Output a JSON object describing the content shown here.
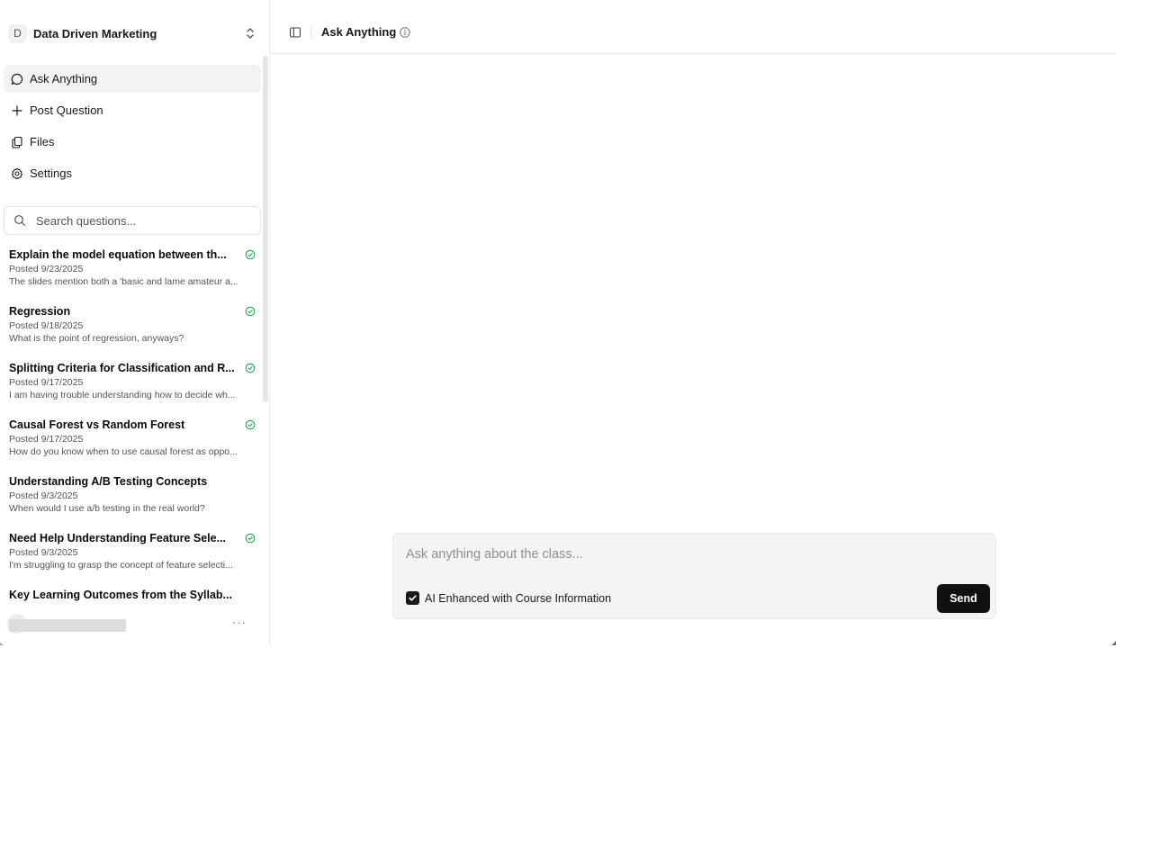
{
  "workspace": {
    "initial": "D",
    "name": "Data Driven Marketing"
  },
  "nav": {
    "items": [
      {
        "label": "Ask Anything",
        "icon": "chat-bubble-icon",
        "active": true
      },
      {
        "label": "Post Question",
        "icon": "plus-icon",
        "active": false
      },
      {
        "label": "Files",
        "icon": "files-icon",
        "active": false
      },
      {
        "label": "Settings",
        "icon": "gear-icon",
        "active": false
      }
    ]
  },
  "search": {
    "placeholder": "Search questions..."
  },
  "questions": [
    {
      "title": "Explain the model equation between th...",
      "date": "Posted 9/23/2025",
      "snippet": "The slides mention both a 'basic and lame amateur a...",
      "answered": true
    },
    {
      "title": "Regression",
      "date": "Posted 9/18/2025",
      "snippet": "What is the point of regression, anyways?",
      "answered": true
    },
    {
      "title": "Splitting Criteria for Classification and R...",
      "date": "Posted 9/17/2025",
      "snippet": "I am having trouble understanding how to decide wh...",
      "answered": true
    },
    {
      "title": "Causal Forest vs Random Forest",
      "date": "Posted 9/17/2025",
      "snippet": "How do you know when to use causal forest as oppo...",
      "answered": true
    },
    {
      "title": "Understanding A/B Testing Concepts",
      "date": "Posted 9/3/2025",
      "snippet": "When would I use a/b testing in the real world?",
      "answered": false
    },
    {
      "title": "Need Help Understanding Feature Sele...",
      "date": "Posted 9/3/2025",
      "snippet": "I'm struggling to grasp the concept of feature selecti...",
      "answered": true
    },
    {
      "title": "Key Learning Outcomes from the Syllab...",
      "date": "",
      "snippet": "",
      "answered": false
    }
  ],
  "user": {
    "more_label": "···"
  },
  "header": {
    "title": "Ask Anything"
  },
  "composer": {
    "placeholder": "Ask anything about the class...",
    "checkbox_label": "AI Enhanced with Course Information",
    "checkbox_checked": true,
    "send_label": "Send"
  },
  "colors": {
    "accent": "#18181b",
    "answered_check": "#16a34a",
    "active_bg": "#f3f3f4"
  }
}
